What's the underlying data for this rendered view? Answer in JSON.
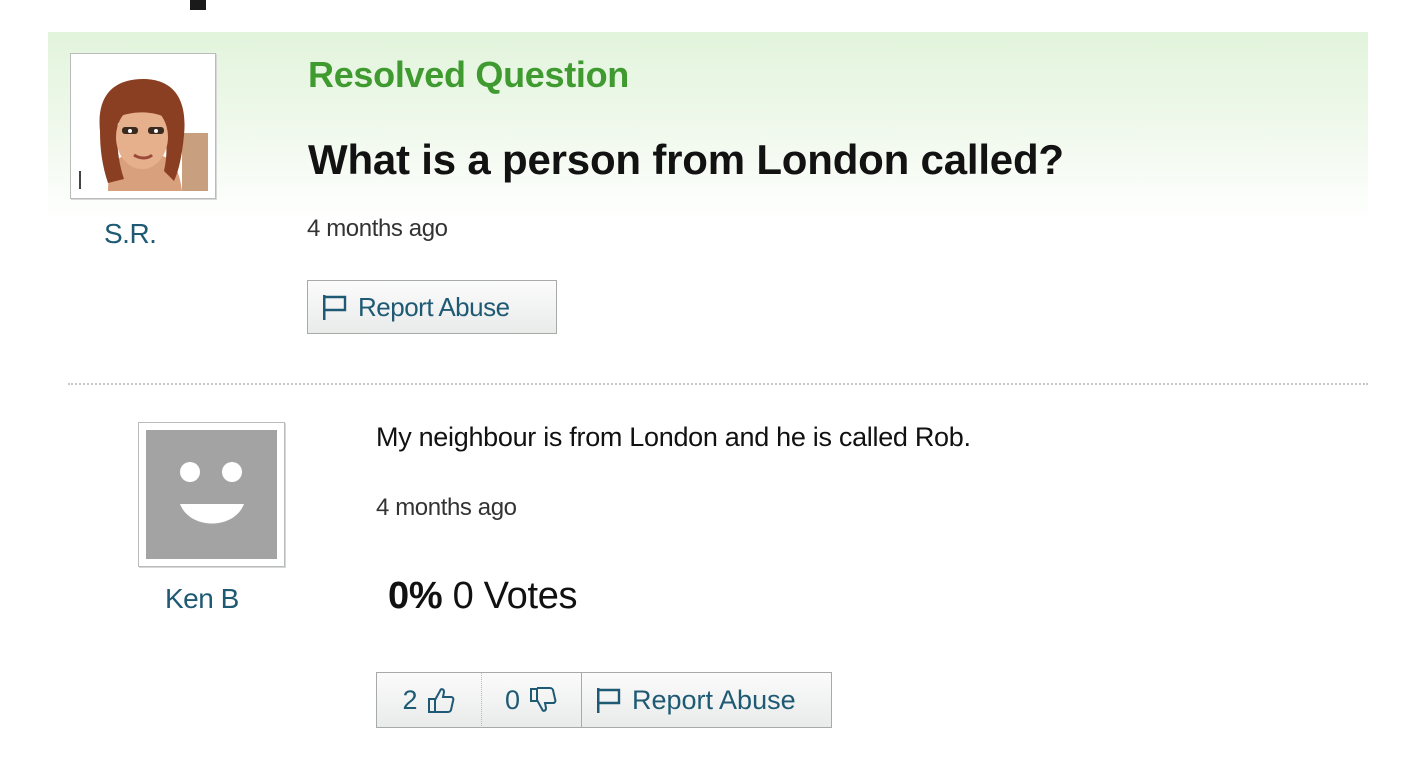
{
  "question": {
    "status_label": "Resolved Question",
    "title": "What is a person from London called?",
    "time": "4 months ago",
    "report_label": "Report Abuse",
    "asker": {
      "name": "S.R.",
      "avatar": "female-cartoon-avatar"
    }
  },
  "answer": {
    "text": "My neighbour is from London and he is called Rob.",
    "time": "4 months ago",
    "vote_percent": "0%",
    "vote_count": "0 Votes",
    "thumbs_up": "2",
    "thumbs_down": "0",
    "report_label": "Report Abuse",
    "answerer": {
      "name": "Ken B",
      "avatar": "smiley-placeholder-avatar"
    }
  },
  "colors": {
    "resolved_green": "#3f9a2f",
    "link_blue": "#1f5a74",
    "header_band": "#e2f4dc"
  }
}
